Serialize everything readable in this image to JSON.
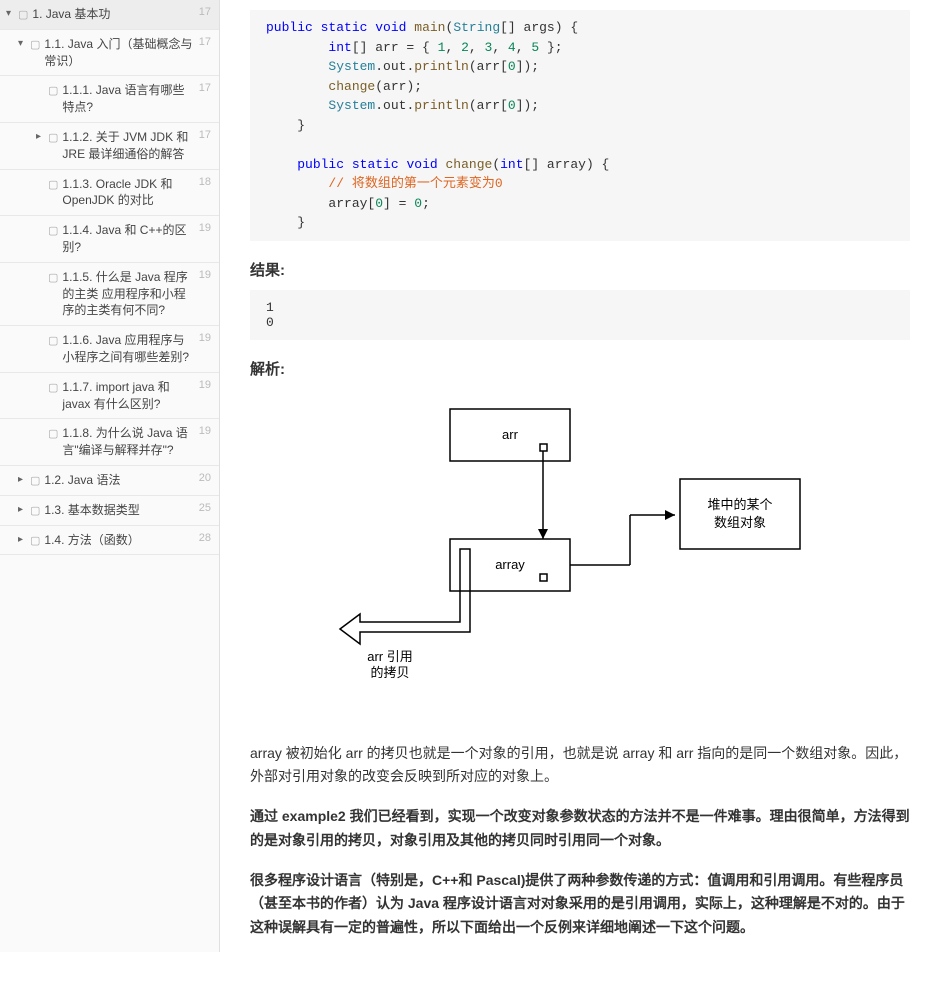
{
  "sidebar": {
    "items": [
      {
        "arrow": "▾",
        "book": "📕",
        "label": "1. Java 基本功",
        "count": 17,
        "level": 0
      },
      {
        "arrow": "▾",
        "book": "📕",
        "label": "1.1. Java 入门（基础概念与常识）",
        "count": 17,
        "level": 1
      },
      {
        "arrow": "",
        "book": "📕",
        "label": "1.1.1. Java 语言有哪些特点?",
        "count": 17,
        "level": 2
      },
      {
        "arrow": "▸",
        "book": "📕",
        "label": "1.1.2. 关于 JVM JDK 和 JRE 最详细通俗的解答",
        "count": 17,
        "level": 2
      },
      {
        "arrow": "",
        "book": "📕",
        "label": "1.1.3. Oracle JDK 和 OpenJDK 的对比",
        "count": 18,
        "level": 2
      },
      {
        "arrow": "",
        "book": "📕",
        "label": "1.1.4. Java 和 C++的区别?",
        "count": 19,
        "level": 2
      },
      {
        "arrow": "",
        "book": "📕",
        "label": "1.1.5. 什么是 Java 程序的主类 应用程序和小程序的主类有何不同?",
        "count": 19,
        "level": 2
      },
      {
        "arrow": "",
        "book": "📕",
        "label": "1.1.6. Java 应用程序与小程序之间有哪些差别?",
        "count": 19,
        "level": 2
      },
      {
        "arrow": "",
        "book": "📕",
        "label": "1.1.7. import java 和 javax 有什么区别?",
        "count": 19,
        "level": 2
      },
      {
        "arrow": "",
        "book": "📕",
        "label": "1.1.8. 为什么说 Java 语言\"编译与解释并存\"?",
        "count": 19,
        "level": 2
      },
      {
        "arrow": "▸",
        "book": "📕",
        "label": "1.2. Java 语法",
        "count": 20,
        "level": 1
      },
      {
        "arrow": "▸",
        "book": "📕",
        "label": "1.3. 基本数据类型",
        "count": 25,
        "level": 1
      },
      {
        "arrow": "▸",
        "book": "📕",
        "label": "1.4. 方法（函数）",
        "count": 28,
        "level": 1
      }
    ]
  },
  "code": {
    "text": "    public static void main(String[] args) {\n        int[] arr = { 1, 2, 3, 4, 5 };\n        System.out.println(arr[0]);\n        change(arr);\n        System.out.println(arr[0]);\n    }\n\n    public static void change(int[] array) {\n        // 将数组的第一个元素变为0\n        array[0] = 0;\n    }"
  },
  "sections": {
    "result_title": "结果:",
    "analysis_title": "解析:",
    "output": "1\n0"
  },
  "diagram": {
    "arr": "arr",
    "array": "array",
    "heap": "堆中的某个数组对象",
    "copy": "arr 引用的拷贝"
  },
  "paragraphs": {
    "p1": "array 被初始化 arr 的拷贝也就是一个对象的引用，也就是说 array 和 arr 指向的是同一个数组对象。因此，外部对引用对象的改变会反映到所对应的对象上。",
    "p2": "通过 example2 我们已经看到，实现一个改变对象参数状态的方法并不是一件难事。理由很简单，方法得到的是对象引用的拷贝，对象引用及其他的拷贝同时引用同一个对象。",
    "p3": "很多程序设计语言（特别是，C++和 Pascal)提供了两种参数传递的方式：值调用和引用调用。有些程序员（甚至本书的作者）认为 Java 程序设计语言对对象采用的是引用调用，实际上，这种理解是不对的。由于这种误解具有一定的普遍性，所以下面给出一个反例来详细地阐述一下这个问题。"
  }
}
